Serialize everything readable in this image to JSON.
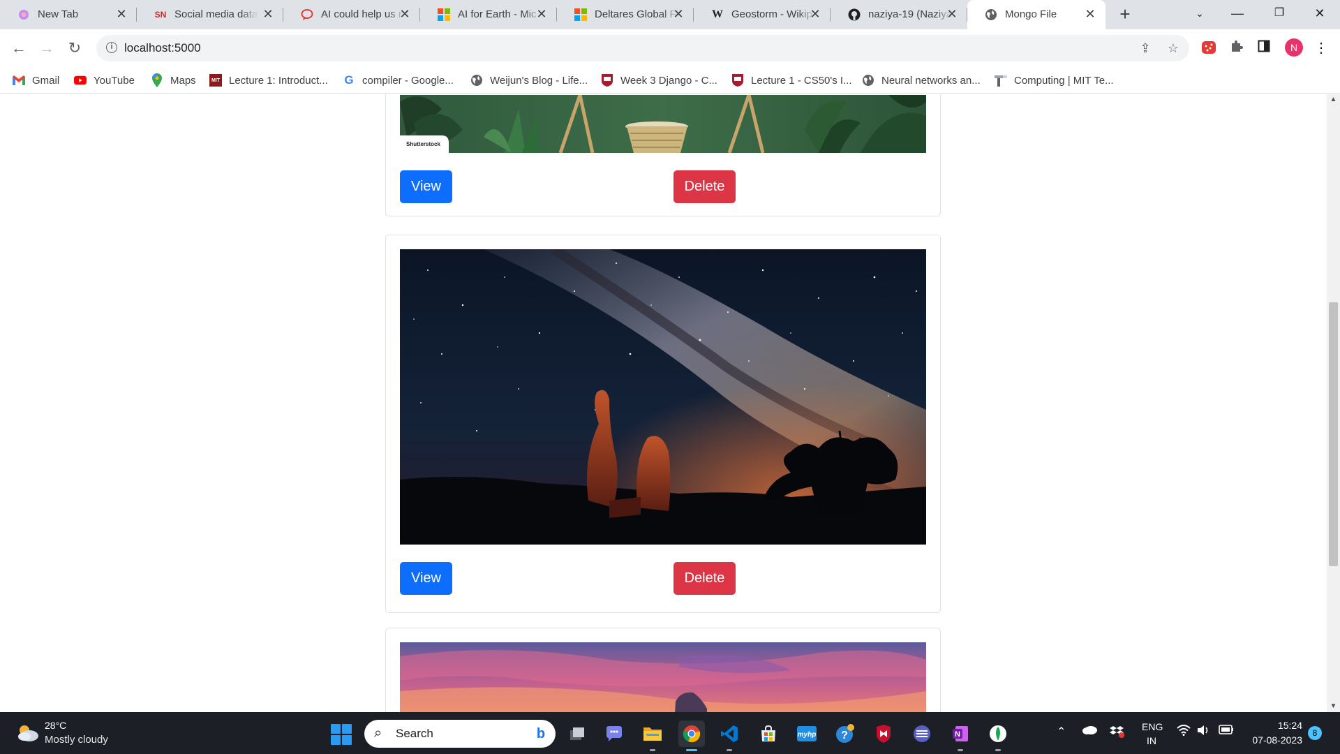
{
  "tabs": [
    {
      "title": "New Tab",
      "icon": "new-tab-icon"
    },
    {
      "title": "Social media data",
      "icon": "sn-icon",
      "fav_text": "SN"
    },
    {
      "title": "AI could help us r",
      "icon": "chat-icon"
    },
    {
      "title": "AI for Earth - Mic",
      "icon": "microsoft-icon"
    },
    {
      "title": "Deltares Global Fl",
      "icon": "microsoft-icon"
    },
    {
      "title": "Geostorm - Wikip",
      "icon": "wikipedia-icon",
      "fav_text": "W"
    },
    {
      "title": "naziya-19 (Naziya",
      "icon": "github-icon"
    },
    {
      "title": "Mongo File",
      "icon": "globe-icon",
      "active": true
    }
  ],
  "toolbar": {
    "url": "localhost:5000",
    "profile_initial": "N"
  },
  "bookmarks": [
    {
      "label": "Gmail",
      "icon": "gmail-icon"
    },
    {
      "label": "YouTube",
      "icon": "youtube-icon"
    },
    {
      "label": "Maps",
      "icon": "maps-icon"
    },
    {
      "label": "Lecture 1: Introduct...",
      "icon": "mit-icon"
    },
    {
      "label": "compiler - Google...",
      "icon": "google-icon"
    },
    {
      "label": "Weijun's Blog - Life...",
      "icon": "globe-icon"
    },
    {
      "label": "Week 3 Django - C...",
      "icon": "harvard-icon"
    },
    {
      "label": "Lecture 1 - CS50's I...",
      "icon": "harvard-icon"
    },
    {
      "label": "Neural networks an...",
      "icon": "globe-icon"
    },
    {
      "label": "Computing | MIT Te...",
      "icon": "mit-tech-icon"
    }
  ],
  "cards": [
    {
      "image": "plants-stand-image",
      "watermark": "Shutterstock",
      "view_label": "View",
      "delete_label": "Delete"
    },
    {
      "image": "milky-way-desert-image",
      "view_label": "View",
      "delete_label": "Delete"
    },
    {
      "image": "sunset-clouds-image"
    }
  ],
  "colors": {
    "view_button": "#0d6efd",
    "delete_button": "#dc3545"
  },
  "taskbar": {
    "weather_temp": "28°C",
    "weather_desc": "Mostly cloudy",
    "search_label": "Search",
    "lang_line1": "ENG",
    "lang_line2": "IN",
    "time": "15:24",
    "date": "07-08-2023",
    "notification_count": "8"
  }
}
